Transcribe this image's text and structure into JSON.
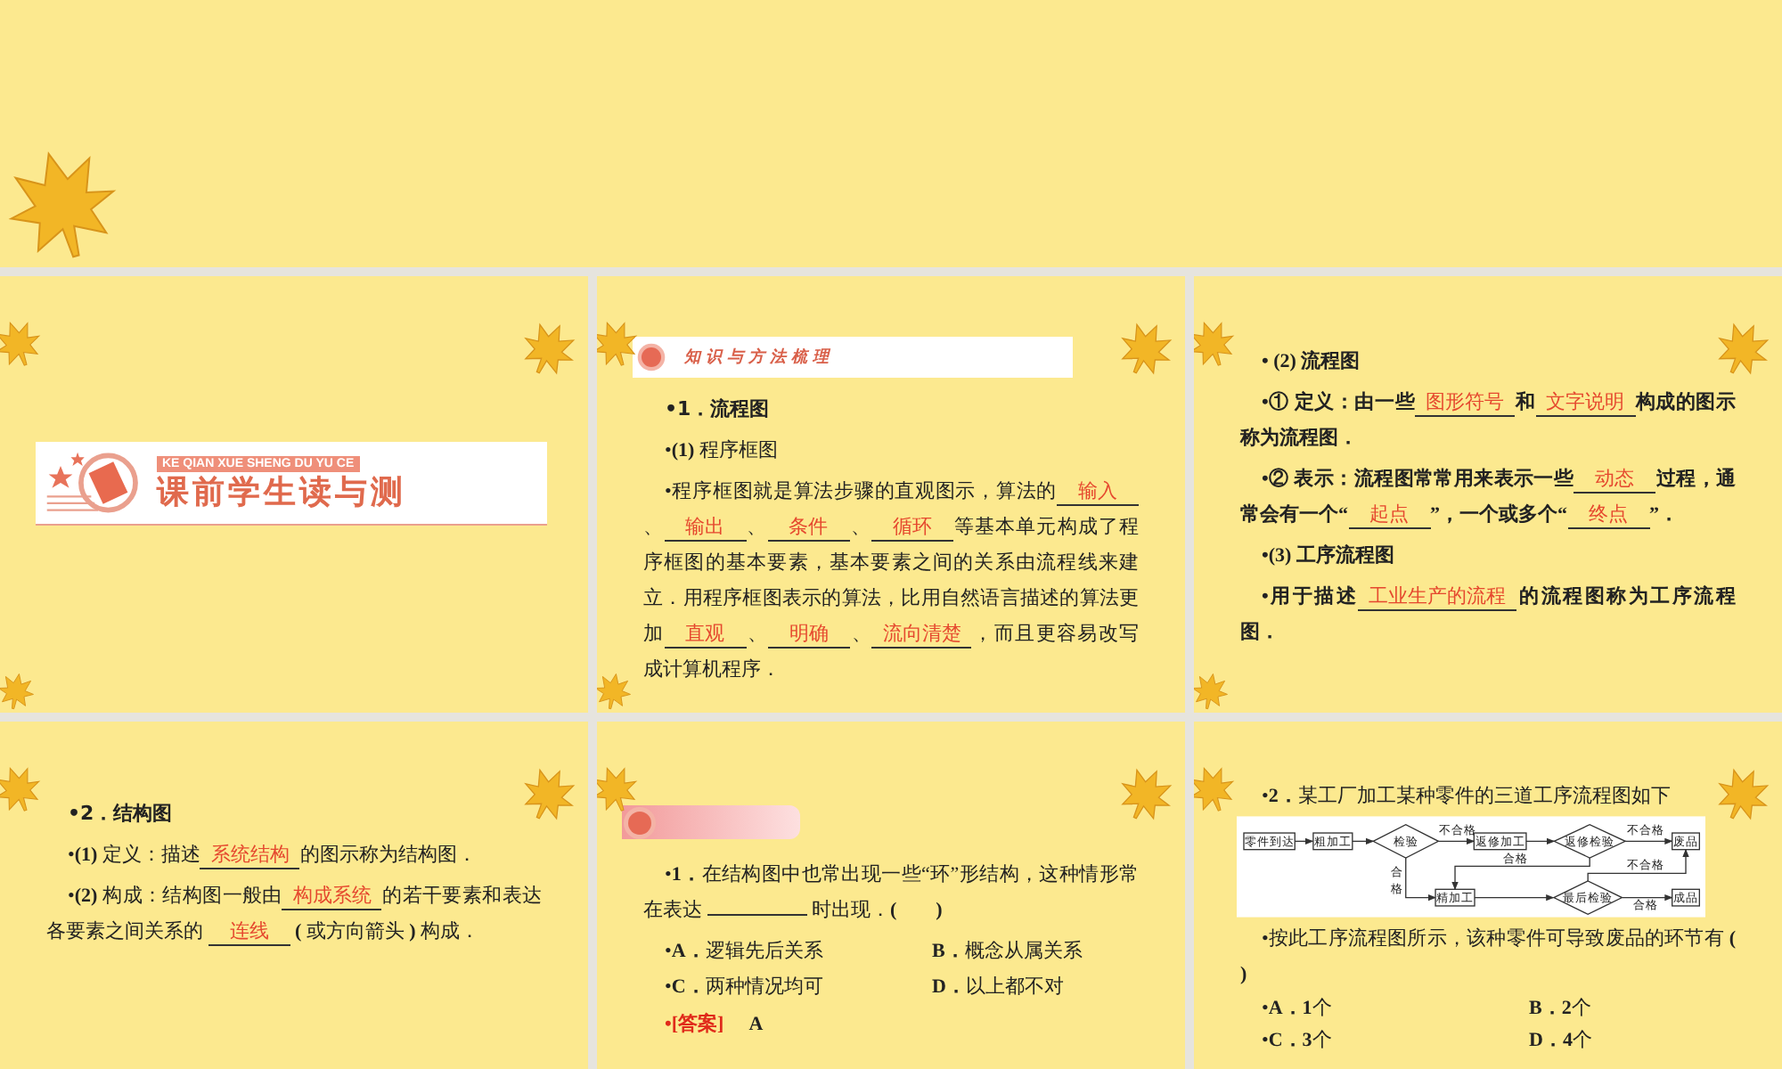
{
  "slides": [
    {
      "kind": "title",
      "banner": {
        "subtitle": "KE QIAN XUE SHENG DU YU CE",
        "title": "课前学生读与测"
      }
    },
    {
      "kind": "content",
      "header": {
        "kind": "ribbon",
        "title": "知识与方法梳理"
      },
      "blocks": [
        {
          "kind": "heading",
          "text": "•1．流程图"
        },
        {
          "kind": "para",
          "bold": false,
          "parts": [
            {
              "kind": "text",
              "text": "•**(1)** 程序框图"
            }
          ]
        },
        {
          "kind": "para",
          "bold": false,
          "parts": [
            {
              "kind": "text",
              "text": "•程序框图就是算法步骤的直观图示，算法的"
            },
            {
              "kind": "blank",
              "answer": "输入"
            },
            {
              "kind": "text",
              "text": "、"
            },
            {
              "kind": "blank",
              "answer": "输出"
            },
            {
              "kind": "text",
              "text": "、"
            },
            {
              "kind": "blank",
              "answer": "条件"
            },
            {
              "kind": "text",
              "text": "、"
            },
            {
              "kind": "blank",
              "answer": "循环"
            },
            {
              "kind": "text",
              "text": "等基本单元构成了程序框图的基本要素，基本要素之间的关系由流程线来建立．用程序框图表示的算法，比用自然语言描述的算法更加"
            },
            {
              "kind": "blank",
              "answer": "直观"
            },
            {
              "kind": "text",
              "text": "、"
            },
            {
              "kind": "blank",
              "answer": "明确"
            },
            {
              "kind": "text",
              "text": "、"
            },
            {
              "kind": "blank",
              "answer": "流向清楚"
            },
            {
              "kind": "text",
              "text": "，而且更容易改写成计算机程序．"
            }
          ]
        }
      ]
    },
    {
      "kind": "content",
      "blocks": [
        {
          "kind": "para",
          "bold": true,
          "parts": [
            {
              "kind": "text",
              "text": "• (2) 流程图"
            }
          ]
        },
        {
          "kind": "para",
          "bold": true,
          "parts": [
            {
              "kind": "text",
              "text": "•① 定义：由一些"
            },
            {
              "kind": "blank",
              "answer": "图形符号"
            },
            {
              "kind": "text",
              "text": "和"
            },
            {
              "kind": "blank",
              "answer": "文字说明"
            },
            {
              "kind": "text",
              "text": "构成的图示称为流程图．"
            }
          ]
        },
        {
          "kind": "para",
          "bold": true,
          "parts": [
            {
              "kind": "text",
              "text": "•② 表示：流程图常常用来表示一些"
            },
            {
              "kind": "blank",
              "answer": "动态"
            },
            {
              "kind": "text",
              "text": "过程，通常会有一个“"
            },
            {
              "kind": "blank",
              "answer": "起点"
            },
            {
              "kind": "text",
              "text": "”，一个或多个“"
            },
            {
              "kind": "blank",
              "answer": "终点"
            },
            {
              "kind": "text",
              "text": "”．"
            }
          ]
        },
        {
          "kind": "para",
          "bold": true,
          "parts": [
            {
              "kind": "text",
              "text": "•(3) 工序流程图"
            }
          ]
        },
        {
          "kind": "para",
          "bold": true,
          "parts": [
            {
              "kind": "text",
              "text": "•用于描述"
            },
            {
              "kind": "blank",
              "answer": "工业生产的流程"
            },
            {
              "kind": "text",
              "text": "的流程图称为工序流程图．"
            }
          ]
        }
      ]
    },
    {
      "kind": "content",
      "blocks": [
        {
          "kind": "heading",
          "text": "•2．结构图"
        },
        {
          "kind": "para",
          "bold": false,
          "parts": [
            {
              "kind": "text",
              "text": "•**(1)** 定义：描述"
            },
            {
              "kind": "blank",
              "answer": "系统结构"
            },
            {
              "kind": "text",
              "text": "的图示称为结构图．"
            }
          ]
        },
        {
          "kind": "para",
          "bold": false,
          "parts": [
            {
              "kind": "text",
              "text": "•**(2)** 构成：结构图一般由"
            },
            {
              "kind": "blank",
              "answer": "构成系统"
            },
            {
              "kind": "text",
              "text": "的若干要素和表达各要素之间关系的 "
            },
            {
              "kind": "blank",
              "answer": "连线"
            },
            {
              "kind": "text",
              "text": " **(** 或方向箭头 **)** 构成．"
            }
          ]
        }
      ]
    },
    {
      "kind": "content",
      "header": {
        "kind": "bar"
      },
      "blocks": [
        {
          "kind": "para",
          "bold": false,
          "parts": [
            {
              "kind": "text",
              "text": "•**1．**在结构图中也常出现一些“环”形结构，这种情形常在表达 "
            },
            {
              "kind": "blank"
            },
            {
              "kind": "text",
              "text": " 时出现．**(　　)**"
            }
          ]
        },
        {
          "kind": "options",
          "items": [
            "•**A．**逻辑先后关系",
            "**B．**概念从属关系",
            "•**C．**两种情况均可",
            "**D．**以上都不对"
          ]
        },
        {
          "kind": "answer",
          "label": "•[答案]",
          "value": "A"
        }
      ]
    },
    {
      "kind": "content",
      "blocks": [
        {
          "kind": "para",
          "bold": false,
          "parts": [
            {
              "kind": "text",
              "text": "•**2．**某工厂加工某种零件的三道工序流程图如下"
            }
          ]
        },
        {
          "kind": "flowchart",
          "nodes": [
            {
              "label": "零件到达",
              "kind": "box"
            },
            {
              "label": "粗加工",
              "kind": "box"
            },
            {
              "label": "检验",
              "kind": "diamond"
            },
            {
              "label": "返修加工",
              "kind": "box"
            },
            {
              "label": "返修检验",
              "kind": "diamond"
            },
            {
              "label": "废品",
              "kind": "box"
            },
            {
              "label": "精加工",
              "kind": "box"
            },
            {
              "label": "最后检验",
              "kind": "diamond"
            },
            {
              "label": "成品",
              "kind": "box"
            }
          ],
          "edge_labels": [
            "不合格",
            "不合格",
            "合格",
            "合格",
            "不合格",
            "合格"
          ]
        },
        {
          "kind": "para",
          "bold": false,
          "parts": [
            {
              "kind": "text",
              "text": "•按此工序流程图所示，该种零件可导致废品的环节有 **(**　**)**"
            }
          ]
        },
        {
          "kind": "options",
          "items": [
            "•**A．1**个",
            "**B．2**个",
            "•**C．3**个",
            "**D．4**个"
          ]
        }
      ]
    }
  ]
}
